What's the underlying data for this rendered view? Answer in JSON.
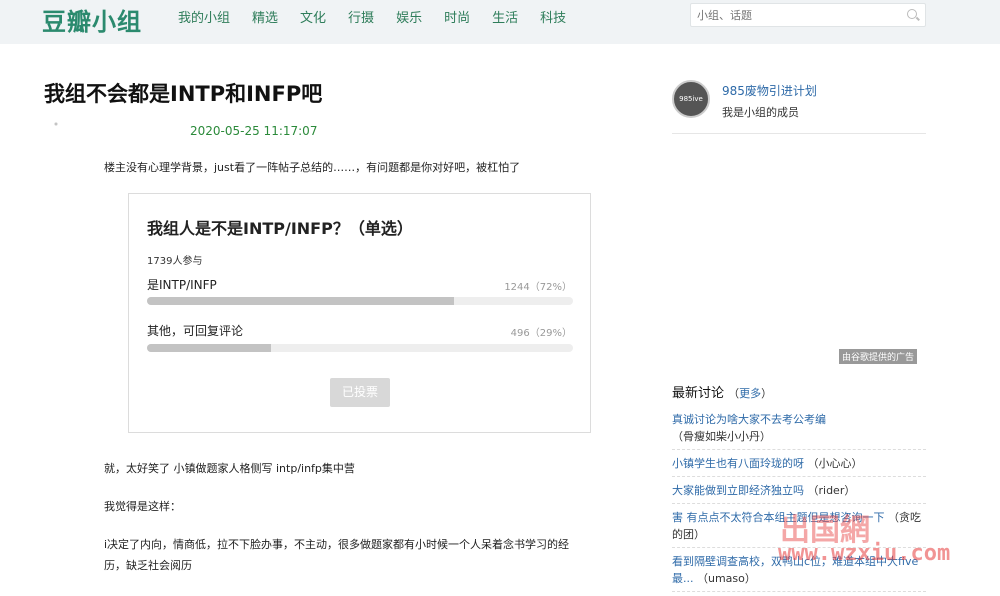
{
  "header": {
    "logo": "豆瓣小组",
    "nav": [
      "我的小组",
      "精选",
      "文化",
      "行摄",
      "娱乐",
      "时尚",
      "生活",
      "科技"
    ],
    "search_placeholder": "小组、话题"
  },
  "post": {
    "title": "我组不会都是INTP和INFP吧",
    "date": "2020-05-25 11:17:07",
    "intro": "楼主没有心理学背景，just看了一阵帖子总结的……，有问题都是你对好吧，被杠怕了",
    "poll": {
      "title": "我组人是不是INTP/INFP？（单选）",
      "participants": "1739人参与",
      "options": [
        {
          "label": "是INTP/INFP",
          "stat": "1244（72%）",
          "fraction": 0.72
        },
        {
          "label": "其他，可回复评论",
          "stat": "496（29%）",
          "fraction": 0.29
        }
      ],
      "button": "已投票"
    },
    "para2": "就，太好笑了 小镇做题家人格侧写 intp/infp集中营",
    "para3": "我觉得是这样：",
    "para4_line1": "i决定了内向，情商低，拉不下脸办事，不主动，很多做题家都有小时候一个人呆着念书学习的经",
    "para4_line2": "历，缺乏社会阅历"
  },
  "sidebar": {
    "group_avatar_text": "985ive",
    "group_name": "985废物引进计划",
    "group_status": "我是小组的成员",
    "ad_label": "由谷歌提供的广告",
    "latest_title": "最新讨论",
    "latest_more": "更多",
    "discussions": [
      {
        "title": "真诚讨论为啥大家不去考公考编",
        "author": "（骨瘦如柴小小丹）"
      },
      {
        "title": "小镇学生也有八面玲珑的呀",
        "author": "（小心心）"
      },
      {
        "title": "大家能做到立即经济独立吗",
        "author": "（rider）"
      },
      {
        "title": "害 有点点不太符合本组主题但是想咨询一下",
        "author": "（贪吃的团）"
      },
      {
        "title": "看到隔壁调查高校，双鸭山c位，难道本组中大five最...",
        "author": "（umaso）"
      }
    ]
  },
  "watermark": {
    "line1": "出国網",
    "line2": "www.wzxiu.com"
  }
}
